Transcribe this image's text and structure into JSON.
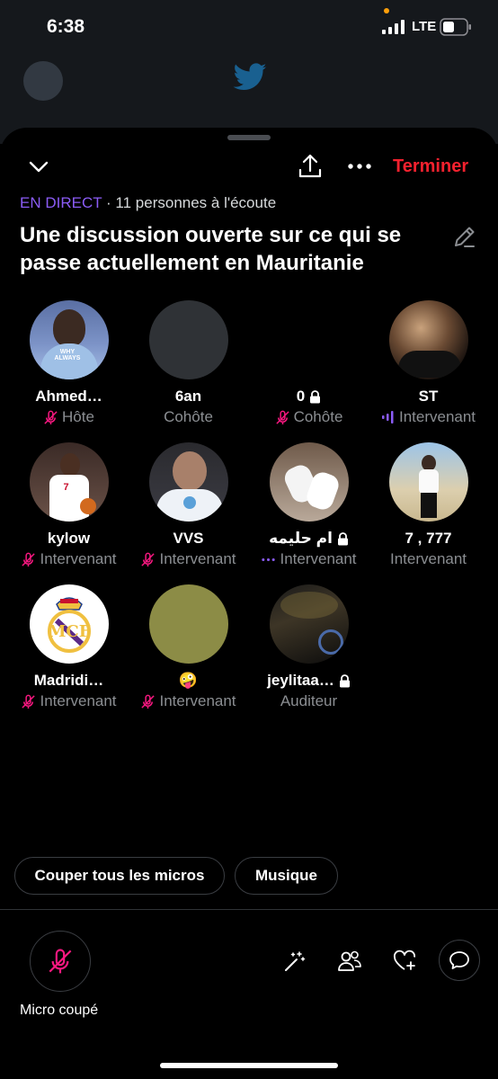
{
  "status": {
    "time": "6:38",
    "network": "LTE"
  },
  "header": {
    "end_label": "Terminer",
    "live_tag": "EN DIRECT",
    "listeners": " · 11 personnes à l'écoute",
    "title": "Une discussion ouverte sur ce qui se passe actuellement en Mauritanie"
  },
  "participants": [
    {
      "name": "Ahmed…",
      "role": "Hôte",
      "role_icon": "mic-off-icon",
      "locked": false
    },
    {
      "name": "6an",
      "role": "Cohôte",
      "role_icon": "",
      "locked": false
    },
    {
      "name": "0",
      "role": "Cohôte",
      "role_icon": "mic-off-icon",
      "locked": true
    },
    {
      "name": "ST",
      "role": "Intervenant",
      "role_icon": "speaking-icon",
      "locked": false
    },
    {
      "name": "kylow",
      "role": "Intervenant",
      "role_icon": "mic-off-icon",
      "locked": false
    },
    {
      "name": "VVS",
      "role": "Intervenant",
      "role_icon": "mic-off-icon",
      "locked": false
    },
    {
      "name": "ام حليمه",
      "role": "Intervenant",
      "role_icon": "dots-icon",
      "locked": true
    },
    {
      "name": "7 , 777",
      "role": "Intervenant",
      "role_icon": "",
      "locked": false
    },
    {
      "name": "Madridi…",
      "role": "Intervenant",
      "role_icon": "mic-off-icon",
      "locked": false
    },
    {
      "name": "🤪",
      "role": "Intervenant",
      "role_icon": "mic-off-icon",
      "locked": false
    },
    {
      "name": "jeylitaa…",
      "role": "Auditeur",
      "role_icon": "",
      "locked": true
    }
  ],
  "actions": {
    "mute_all": "Couper tous les micros",
    "music": "Musique"
  },
  "mic": {
    "label": "Micro coupé"
  },
  "colors": {
    "accent_red": "#f4212e",
    "live_purple": "#8b5cf6",
    "mic_off_pink": "#f91880"
  }
}
